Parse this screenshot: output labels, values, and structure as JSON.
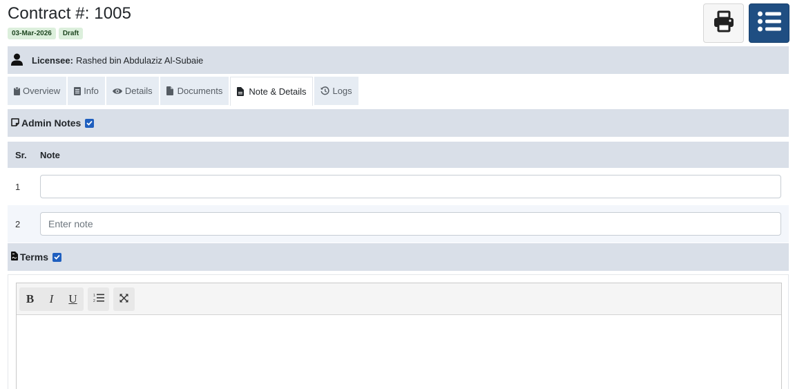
{
  "header": {
    "title": "Contract #: 1005",
    "badges": [
      "03-Mar-2026",
      "Draft"
    ]
  },
  "actions": {
    "print_icon": "print-icon",
    "list_icon": "list-icon"
  },
  "licensee": {
    "icon": "user-icon",
    "label": "Licensee:",
    "name": "Rashed bin Abdulaziz Al-Subaie"
  },
  "tabs": [
    {
      "label": "Overview",
      "icon": "clipboard-icon"
    },
    {
      "label": "Info",
      "icon": "document-list-icon"
    },
    {
      "label": "Details",
      "icon": "eye-icon"
    },
    {
      "label": "Documents",
      "icon": "file-icon"
    },
    {
      "label": "Note & Details",
      "icon": "file-text-icon",
      "active": true
    },
    {
      "label": "Logs",
      "icon": "history-icon"
    }
  ],
  "admin_notes": {
    "title": "Admin Notes",
    "checked": true,
    "columns": [
      "Sr.",
      "Note"
    ],
    "rows": [
      {
        "sr": "1",
        "value": "",
        "placeholder": ""
      },
      {
        "sr": "2",
        "value": "",
        "placeholder": "Enter note"
      }
    ]
  },
  "terms": {
    "title": "Terms",
    "checked": true,
    "toolbar": [
      "B",
      "I",
      "U"
    ]
  },
  "colors": {
    "primary": "#1f4e82",
    "bar": "#d9dfe8",
    "badge_bg": "#dcefdc",
    "checkbox": "#1f5fbf"
  }
}
